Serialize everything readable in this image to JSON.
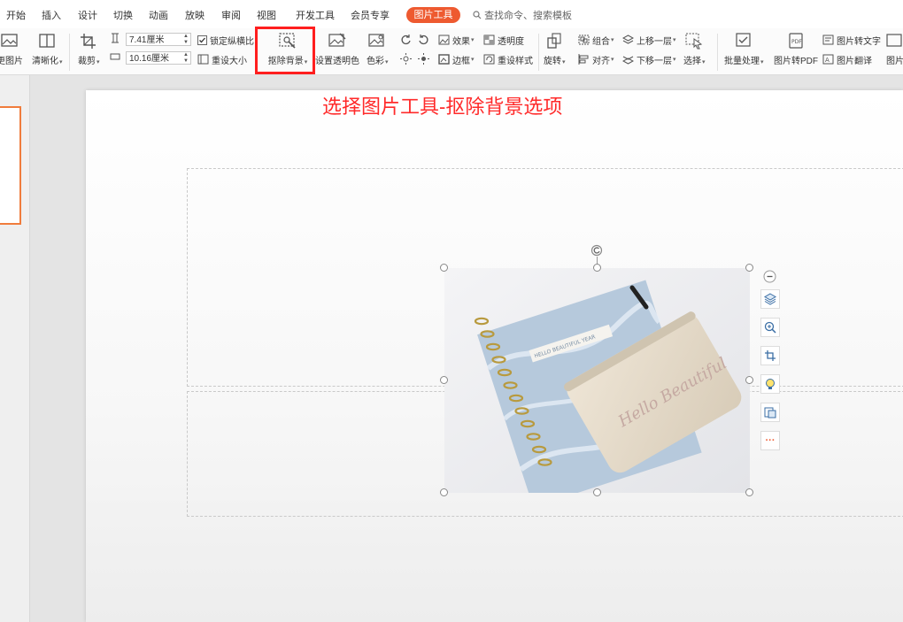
{
  "menubar": {
    "tabs": [
      "开始",
      "插入",
      "设计",
      "切换",
      "动画",
      "放映",
      "审阅",
      "视图",
      "开发工具",
      "会员专享"
    ],
    "active_tab": "图片工具",
    "search_placeholder": "查找命令、搜索模板"
  },
  "ribbon": {
    "change_picture": "更图片",
    "sharpen": "清晰化",
    "crop": "裁剪",
    "height_value": "7.41厘米",
    "width_value": "10.16厘米",
    "lock_ratio": "锁定纵横比",
    "reset_size": "重设大小",
    "remove_background": "抠除背景",
    "set_transparent_color": "设置透明色",
    "color": "色彩",
    "effects": "效果",
    "transparency": "透明度",
    "border": "边框",
    "reset_style": "重设样式",
    "rotate": "旋转",
    "group": "组合",
    "align": "对齐",
    "bring_forward": "上移一层",
    "send_backward": "下移一层",
    "select": "选择",
    "batch_process": "批量处理",
    "pic_to_pdf": "图片转PDF",
    "pic_to_text": "图片转文字",
    "pic_translate": "图片翻译",
    "pic_more": "图片"
  },
  "slide": {
    "title": "选择图片工具-抠除背景选项"
  },
  "image": {
    "card_text": "HELLO BEAUTIFUL YEAR",
    "pouch_text": "Hello Beautiful"
  },
  "side_toolbar": {
    "more": "···"
  },
  "colors": {
    "accent": "#ee5a30",
    "highlight": "#ff1e1e",
    "title": "#ff2a2a"
  }
}
